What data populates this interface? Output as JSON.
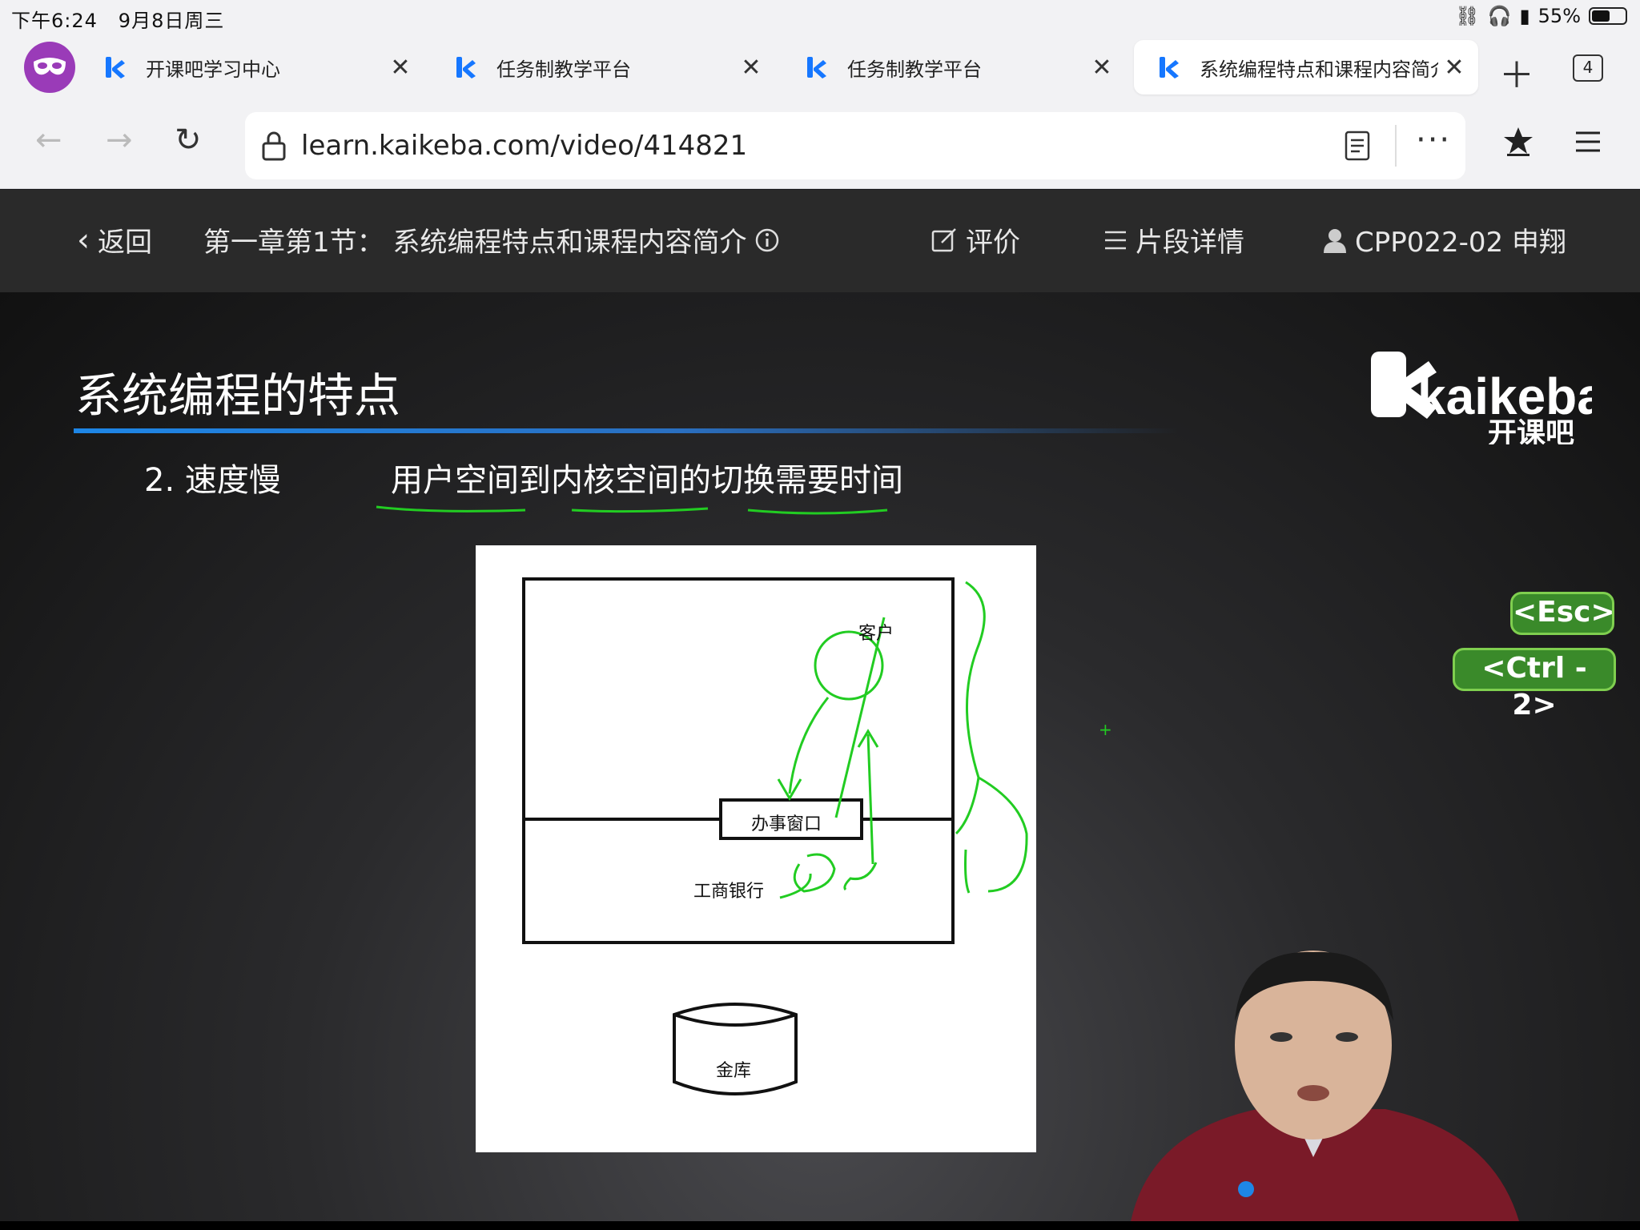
{
  "status_bar": {
    "time": "下午6:24",
    "date": "9月8日周三",
    "battery": "55%",
    "battery_level": 0.55
  },
  "tabs": [
    {
      "label": "开课吧学习中心",
      "active": false
    },
    {
      "label": "任务制教学平台",
      "active": false
    },
    {
      "label": "任务制教学平台",
      "active": false
    },
    {
      "label": "系统编程特点和课程内容简介",
      "active": true
    }
  ],
  "tab_count": "4",
  "address_bar": {
    "url": "learn.kaikeba.com/video/414821"
  },
  "course_header": {
    "back_label": "返回",
    "lesson_title": "第一章第1节：  系统编程特点和课程内容简介",
    "review_label": "评价",
    "segment_label": "片段详情",
    "user_label": "CPP022-02 申翔"
  },
  "slide": {
    "title": "系统编程的特点",
    "point_label": "2. 速度慢",
    "point_desc": "用户空间到内核空间的切换需要时间",
    "brand_name": "kaikeba",
    "brand_sub": "开课吧",
    "whiteboard": {
      "customer": "客户",
      "window": "办事窗口",
      "bank": "工商银行",
      "vault": "金库"
    }
  },
  "shortcuts": {
    "esc": "<Esc>",
    "ctrl2": "<Ctrl - 2>"
  },
  "colors": {
    "accent_blue": "#1e86e6",
    "annotation_green": "#22cc22",
    "shortcut_green": "#3a8a2a",
    "profile_purple": "#9a3bb8"
  }
}
